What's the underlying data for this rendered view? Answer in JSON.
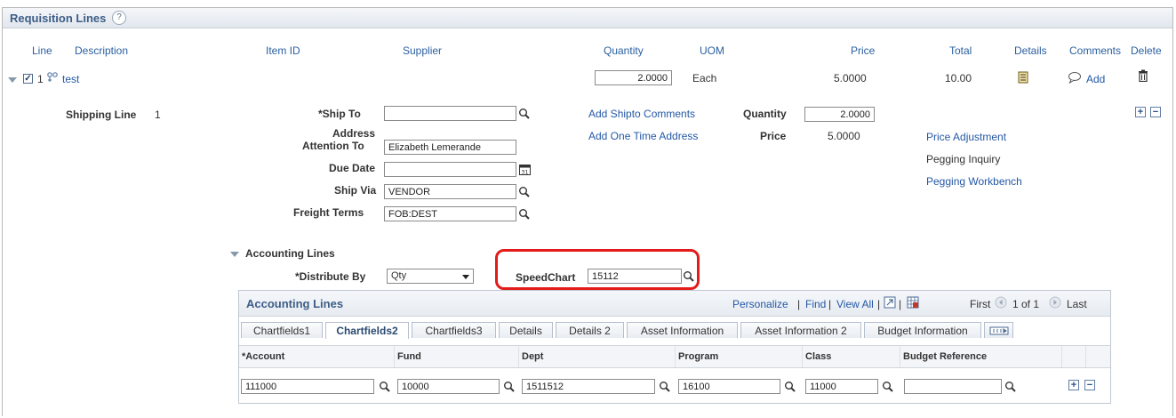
{
  "section": {
    "title": "Requisition Lines",
    "help": "?"
  },
  "columns": {
    "line": "Line",
    "description": "Description",
    "item_id": "Item ID",
    "supplier": "Supplier",
    "quantity": "Quantity",
    "uom": "UOM",
    "price": "Price",
    "total": "Total",
    "details": "Details",
    "comments": "Comments",
    "delete": "Delete"
  },
  "line_row": {
    "line_no": "1",
    "description": "test",
    "quantity": "2.0000",
    "uom": "Each",
    "price": "5.0000",
    "total": "10.00",
    "comments_link": "Add"
  },
  "shipping": {
    "label": "Shipping Line",
    "number": "1",
    "ship_to_label": "*Ship To",
    "ship_to_value": "",
    "address_label": "Address",
    "attention_label": "Attention To",
    "attention_value": "Elizabeth Lemerande",
    "due_date_label": "Due Date",
    "due_date_value": "",
    "ship_via_label": "Ship Via",
    "ship_via_value": "VENDOR",
    "freight_label": "Freight Terms",
    "freight_value": "FOB:DEST",
    "add_shipto_comments": "Add Shipto Comments",
    "add_one_time_address": "Add One Time Address",
    "quantity_label": "Quantity",
    "quantity_value": "2.0000",
    "price_label": "Price",
    "price_value": "5.0000",
    "price_adjustment": "Price Adjustment",
    "pegging_inquiry": "Pegging Inquiry",
    "pegging_workbench": "Pegging Workbench"
  },
  "accounting": {
    "section_label": "Accounting Lines",
    "distribute_label": "*Distribute By",
    "distribute_value": "Qty",
    "speedchart_label": "SpeedChart",
    "speedchart_value": "15112"
  },
  "grid": {
    "title": "Accounting Lines",
    "personalize": "Personalize",
    "find": "Find",
    "view_all": "View All",
    "sep": "|",
    "first": "First",
    "pager": "1 of 1",
    "last": "Last",
    "tabs": [
      "Chartfields1",
      "Chartfields2",
      "Chartfields3",
      "Details",
      "Details 2",
      "Asset Information",
      "Asset Information 2",
      "Budget Information"
    ],
    "headers": [
      "*Account",
      "Fund",
      "Dept",
      "Program",
      "Class",
      "Budget Reference"
    ],
    "row": [
      "111000",
      "10000",
      "1511512",
      "16100",
      "11000",
      ""
    ]
  },
  "colors": {
    "link": "#2458a6",
    "header_text": "#3d5d86",
    "highlight": "#e31b1b"
  }
}
